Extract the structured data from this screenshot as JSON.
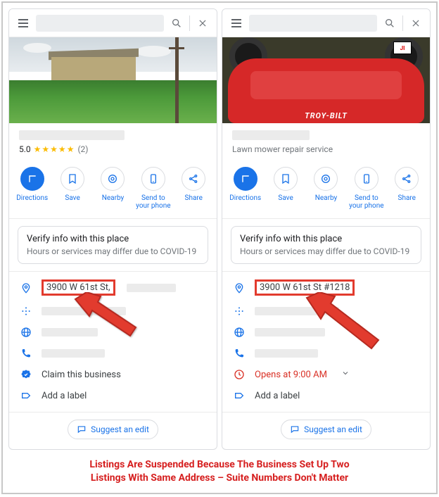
{
  "left": {
    "rating": "5.0",
    "stars": "★★★★★",
    "review_count": "(2)",
    "actions": {
      "directions": "Directions",
      "save": "Save",
      "nearby": "Nearby",
      "send": "Send to your phone",
      "share": "Share"
    },
    "covid": {
      "title": "Verify info with this place",
      "sub": "Hours or services may differ due to COVID-19"
    },
    "address": "3900 W 61st St,",
    "claim": "Claim this business",
    "add_label": "Add a label",
    "suggest": "Suggest an edit"
  },
  "right": {
    "subtitle": "Lawn mower repair service",
    "mower_brand": "TROY-BILT",
    "flag": "JI",
    "actions": {
      "directions": "Directions",
      "save": "Save",
      "nearby": "Nearby",
      "send": "Send to your phone",
      "share": "Share"
    },
    "covid": {
      "title": "Verify info with this place",
      "sub": "Hours or services may differ due to COVID-19"
    },
    "address": "3900 W 61st St #1218",
    "hours": "Opens at 9:00 AM",
    "add_label": "Add a label",
    "suggest": "Suggest an edit"
  },
  "caption": {
    "line1": "Listings Are Suspended Because The Business Set Up Two",
    "line2": "Listings With Same Address – Suite Numbers Don't Matter"
  }
}
